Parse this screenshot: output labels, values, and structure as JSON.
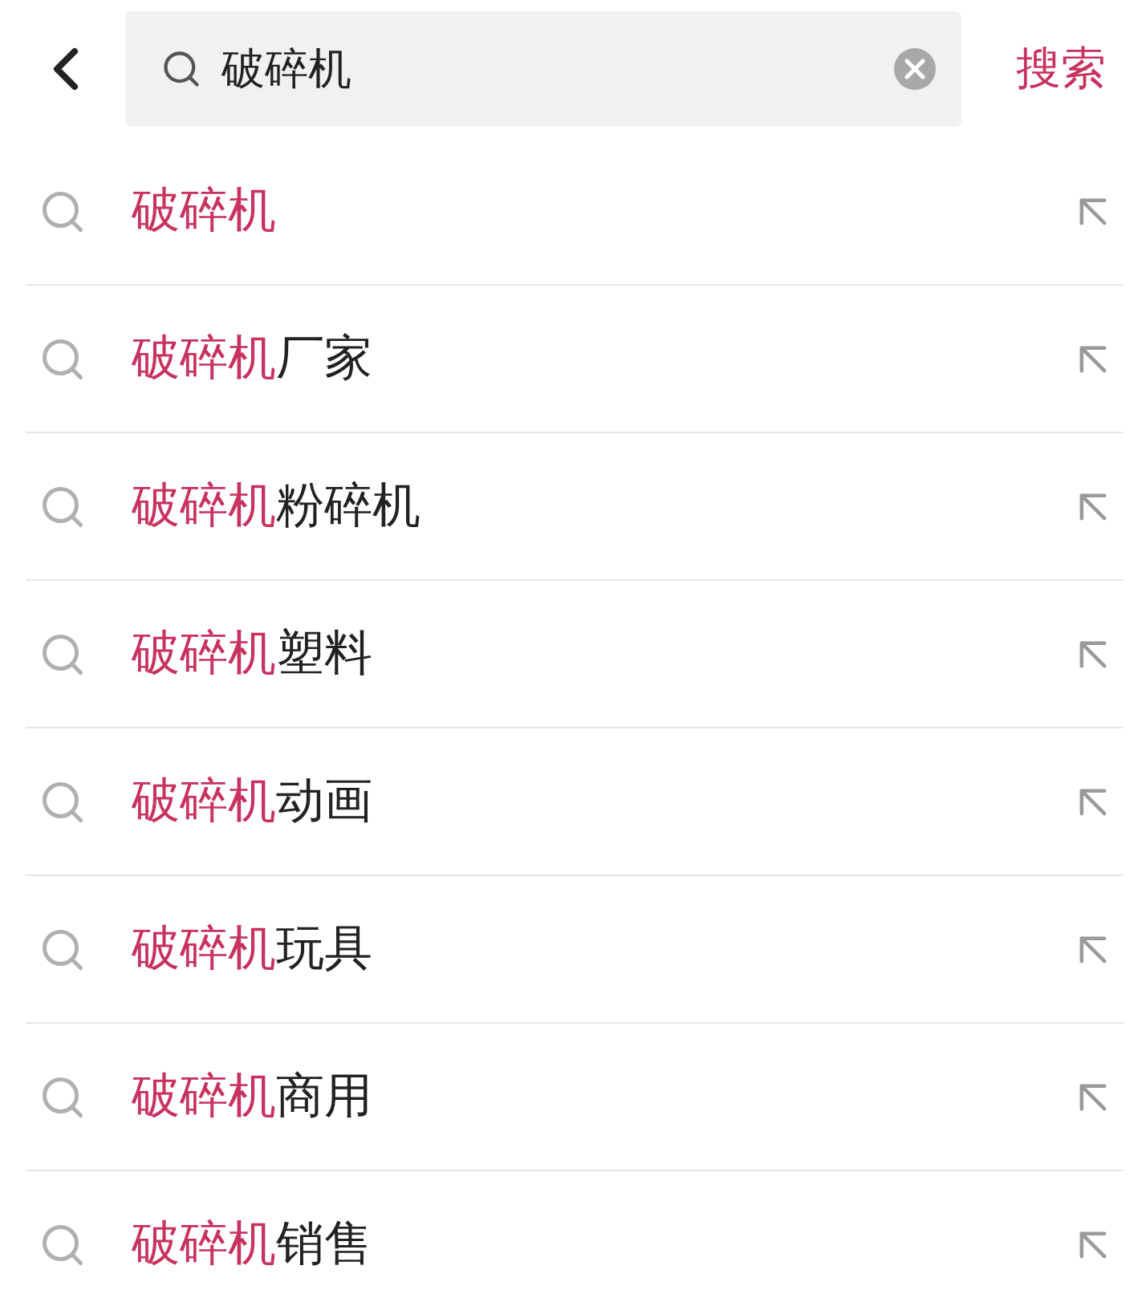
{
  "search_bar": {
    "query": "破碎机",
    "submit_label": "搜索"
  },
  "suggestions": [
    {
      "match": "破碎机"
    },
    {
      "match": "破碎机",
      "rest": "厂家"
    },
    {
      "match": "破碎机",
      "rest": "粉碎机"
    },
    {
      "match": "破碎机",
      "rest": "塑料"
    },
    {
      "match": "破碎机",
      "rest": "动画"
    },
    {
      "match": "破碎机",
      "rest": "玩具"
    },
    {
      "match": "破碎机",
      "rest": "商用"
    },
    {
      "match": "破碎机",
      "rest": "销售"
    }
  ]
}
